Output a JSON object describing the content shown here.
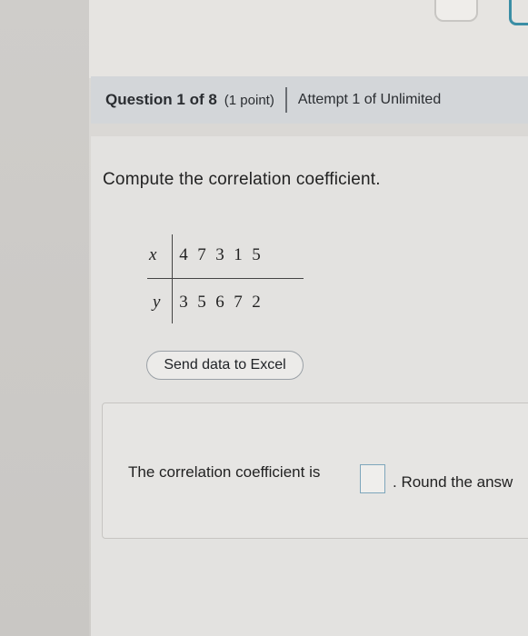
{
  "question_header": {
    "title": "Question 1 of 8",
    "points": "(1 point)",
    "attempt": "Attempt 1 of Unlimited"
  },
  "prompt": "Compute the correlation coefficient.",
  "data_table": {
    "x_label": "x",
    "y_label": "y",
    "x_values": [
      "4",
      "7",
      "3",
      "1",
      "5"
    ],
    "y_values": [
      "3",
      "5",
      "6",
      "7",
      "2"
    ]
  },
  "excel_button_label": "Send data to Excel",
  "answer": {
    "lead_text": "The correlation coefficient is",
    "trail_text": ". Round the answ",
    "input_value": ""
  },
  "colors": {
    "header_bg": "#d3d6d9",
    "input_border": "#7ea6bb",
    "top_icon_accent": "#3b8ea5"
  }
}
